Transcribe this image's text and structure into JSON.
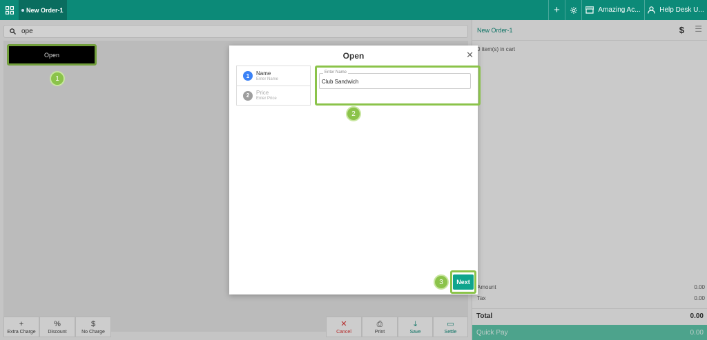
{
  "topbar": {
    "order_tab": "New Order-1",
    "store_label": "Amazing Ac...",
    "help_label": "Help Desk U...",
    "accent_color": "#0c8a78"
  },
  "search": {
    "value": "ope",
    "icon": "search-icon"
  },
  "items": [
    {
      "label": "Open"
    }
  ],
  "bottom_actions": [
    {
      "label": "Extra Charge",
      "icon": "+"
    },
    {
      "label": "Discount",
      "icon": "%"
    },
    {
      "label": "No Charge",
      "icon": "$"
    },
    {
      "label": "Cancel",
      "icon": "✕"
    },
    {
      "label": "Print",
      "icon": "⎙"
    },
    {
      "label": "Save",
      "icon": "⤓"
    },
    {
      "label": "Settle",
      "icon": "▭"
    }
  ],
  "cart": {
    "title": "New Order-1",
    "count_text": "0 item(s) in cart",
    "amount_label": "Amount",
    "amount_value": "0.00",
    "tax_label": "Tax",
    "tax_value": "0.00",
    "total_label": "Total",
    "total_value": "0.00",
    "quick_pay_label": "Quick Pay",
    "quick_pay_value": "0.00"
  },
  "modal": {
    "title": "Open",
    "steps": [
      {
        "num": "1",
        "title": "Name",
        "hint": "Enter Name",
        "active": true
      },
      {
        "num": "2",
        "title": "Price",
        "hint": "Enter Price",
        "active": false
      }
    ],
    "field_label": "Enter Name",
    "field_value": "Club Sandwich",
    "next_label": "Next"
  },
  "callouts": [
    "1",
    "2",
    "3"
  ]
}
